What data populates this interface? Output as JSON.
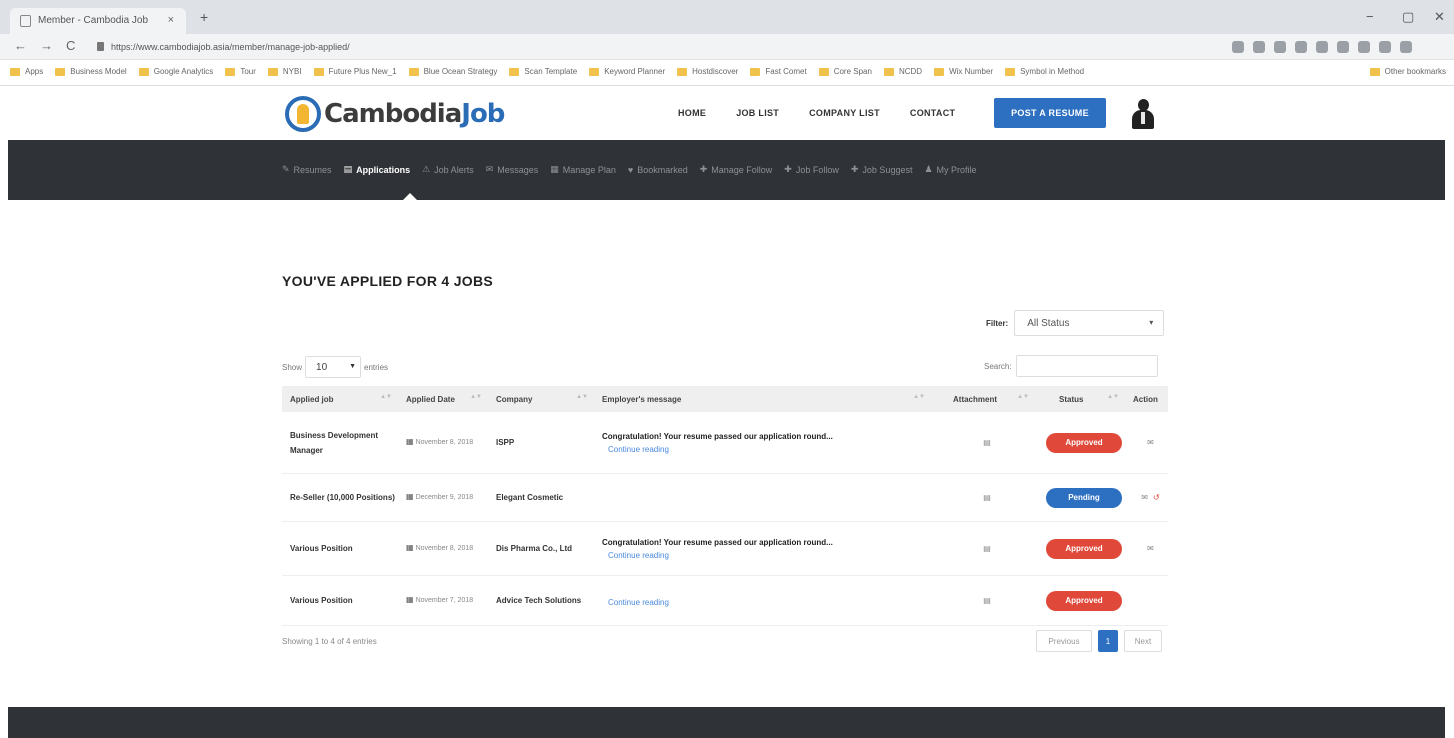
{
  "browser": {
    "tab_title": "Member - Cambodia Job",
    "tab_close": "×",
    "new_tab": "+",
    "url": "https://www.cambodiajob.asia/member/manage-job-applied/",
    "back": "←",
    "forward": "→",
    "reload": "C",
    "minimize": "−",
    "maximize": "▢",
    "close": "✕",
    "bookmarks": [
      "Apps",
      "Business Model",
      "Google Analytics",
      "Tour",
      "NYBI",
      "Future Plus New_1",
      "Blue Ocean Strategy",
      "Scan Template",
      "Keyword Planner",
      "Hostdiscover",
      "Fast Comet",
      "Core Span",
      "NCDD",
      "Wix Number",
      "Symbol in Method"
    ],
    "other_bookmarks": "Other bookmarks"
  },
  "header": {
    "logo_part1": "Cambodia",
    "logo_part2": "Job",
    "nav": [
      "HOME",
      "JOB LIST",
      "COMPANY LIST",
      "CONTACT"
    ],
    "post_resume": "POST A RESUME"
  },
  "member_nav": [
    {
      "icon": "✎",
      "label": "Resumes",
      "active": false
    },
    {
      "icon": "▤",
      "label": "Applications",
      "active": true
    },
    {
      "icon": "⚠",
      "label": "Job Alerts",
      "active": false
    },
    {
      "icon": "✉",
      "label": "Messages",
      "active": false
    },
    {
      "icon": "▦",
      "label": "Manage Plan",
      "active": false
    },
    {
      "icon": "♥",
      "label": "Bookmarked",
      "active": false
    },
    {
      "icon": "✚",
      "label": "Manage Follow",
      "active": false
    },
    {
      "icon": "✚",
      "label": "Job Follow",
      "active": false
    },
    {
      "icon": "✚",
      "label": "Job Suggest",
      "active": false
    },
    {
      "icon": "♟",
      "label": "My Profile",
      "active": false
    }
  ],
  "main": {
    "title": "YOU'VE APPLIED FOR 4 JOBS",
    "filter_label": "Filter:",
    "filter_value": "All Status",
    "show_label": "Show",
    "length_value": "10",
    "entries_label": "entries",
    "search_label": "Search:",
    "columns": [
      "Applied job",
      "Applied Date",
      "Company",
      "Employer's message",
      "Attachment",
      "Status",
      "Action"
    ],
    "rows": [
      {
        "job": "Business Development Manager",
        "date": "November 8, 2018",
        "company": "ISPP",
        "message": "Congratulation! Your resume passed our application round...",
        "link": "Continue reading",
        "status": "Approved",
        "status_type": "approved",
        "actions": 1
      },
      {
        "job": "Re-Seller (10,000 Positions)",
        "date": "December 9, 2018",
        "company": "Elegant Cosmetic",
        "message": "",
        "link": "",
        "status": "Pending",
        "status_type": "pending",
        "actions": 2
      },
      {
        "job": "Various Position",
        "date": "November 8, 2018",
        "company": "Dis Pharma Co., Ltd",
        "message": "Congratulation! Your resume passed our application round...",
        "link": "Continue reading",
        "status": "Approved",
        "status_type": "approved",
        "actions": 1
      },
      {
        "job": "Various Position",
        "date": "November 7, 2018",
        "company": "Advice Tech Solutions",
        "message": "",
        "link": "Continue reading",
        "status": "Approved",
        "status_type": "approved",
        "actions": 0
      }
    ],
    "info": "Showing 1 to 4 of 4 entries",
    "prev": "Previous",
    "page": "1",
    "next": "Next"
  }
}
